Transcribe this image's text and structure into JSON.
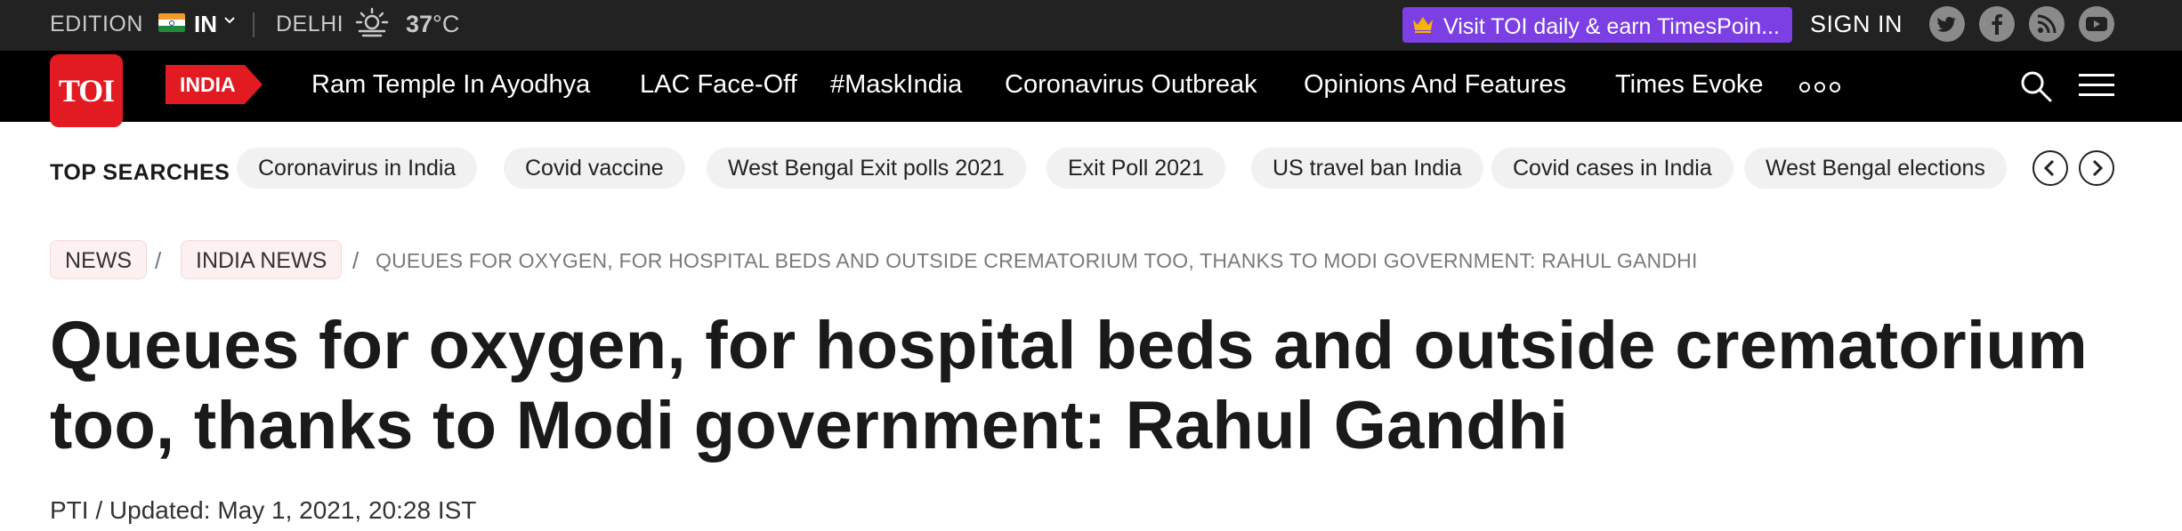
{
  "topbar": {
    "edition_label": "EDITION",
    "edition_value": "IN",
    "city": "DELHI",
    "temperature": "37",
    "temperature_unit": "°C",
    "promo_text": "Visit TOI daily & earn TimesPoin...",
    "signin": "SIGN IN",
    "social_icons": [
      "twitter-icon",
      "facebook-icon",
      "rss-icon",
      "youtube-icon"
    ]
  },
  "nav": {
    "logo": "TOI",
    "section_tag": "INDIA",
    "links": [
      "Ram Temple In Ayodhya",
      "LAC Face-Off",
      "#MaskIndia",
      "Coronavirus Outbreak",
      "Opinions And Features",
      "Times Evoke"
    ]
  },
  "top_searches": {
    "label": "TOP SEARCHES",
    "chips": [
      "Coronavirus in India",
      "Covid vaccine",
      "West Bengal Exit polls 2021",
      "Exit Poll 2021",
      "US travel ban India",
      "Covid cases in India",
      "West Bengal elections"
    ]
  },
  "breadcrumb": {
    "items": [
      "NEWS",
      "INDIA NEWS"
    ],
    "separator": "/",
    "current": "QUEUES FOR OXYGEN, FOR HOSPITAL BEDS AND OUTSIDE CREMATORIUM TOO, THANKS TO MODI GOVERNMENT: RAHUL GANDHI"
  },
  "article": {
    "headline": "Queues for oxygen, for hospital beds and outside crematorium too, thanks to Modi government: Rahul Gandhi",
    "byline": "PTI / Updated: May 1, 2021, 20:28 IST"
  },
  "colors": {
    "brand_red": "#e21b22",
    "promo_purple": "#7b3fe4",
    "topbar_bg": "#222222",
    "nav_bg": "#000000"
  }
}
